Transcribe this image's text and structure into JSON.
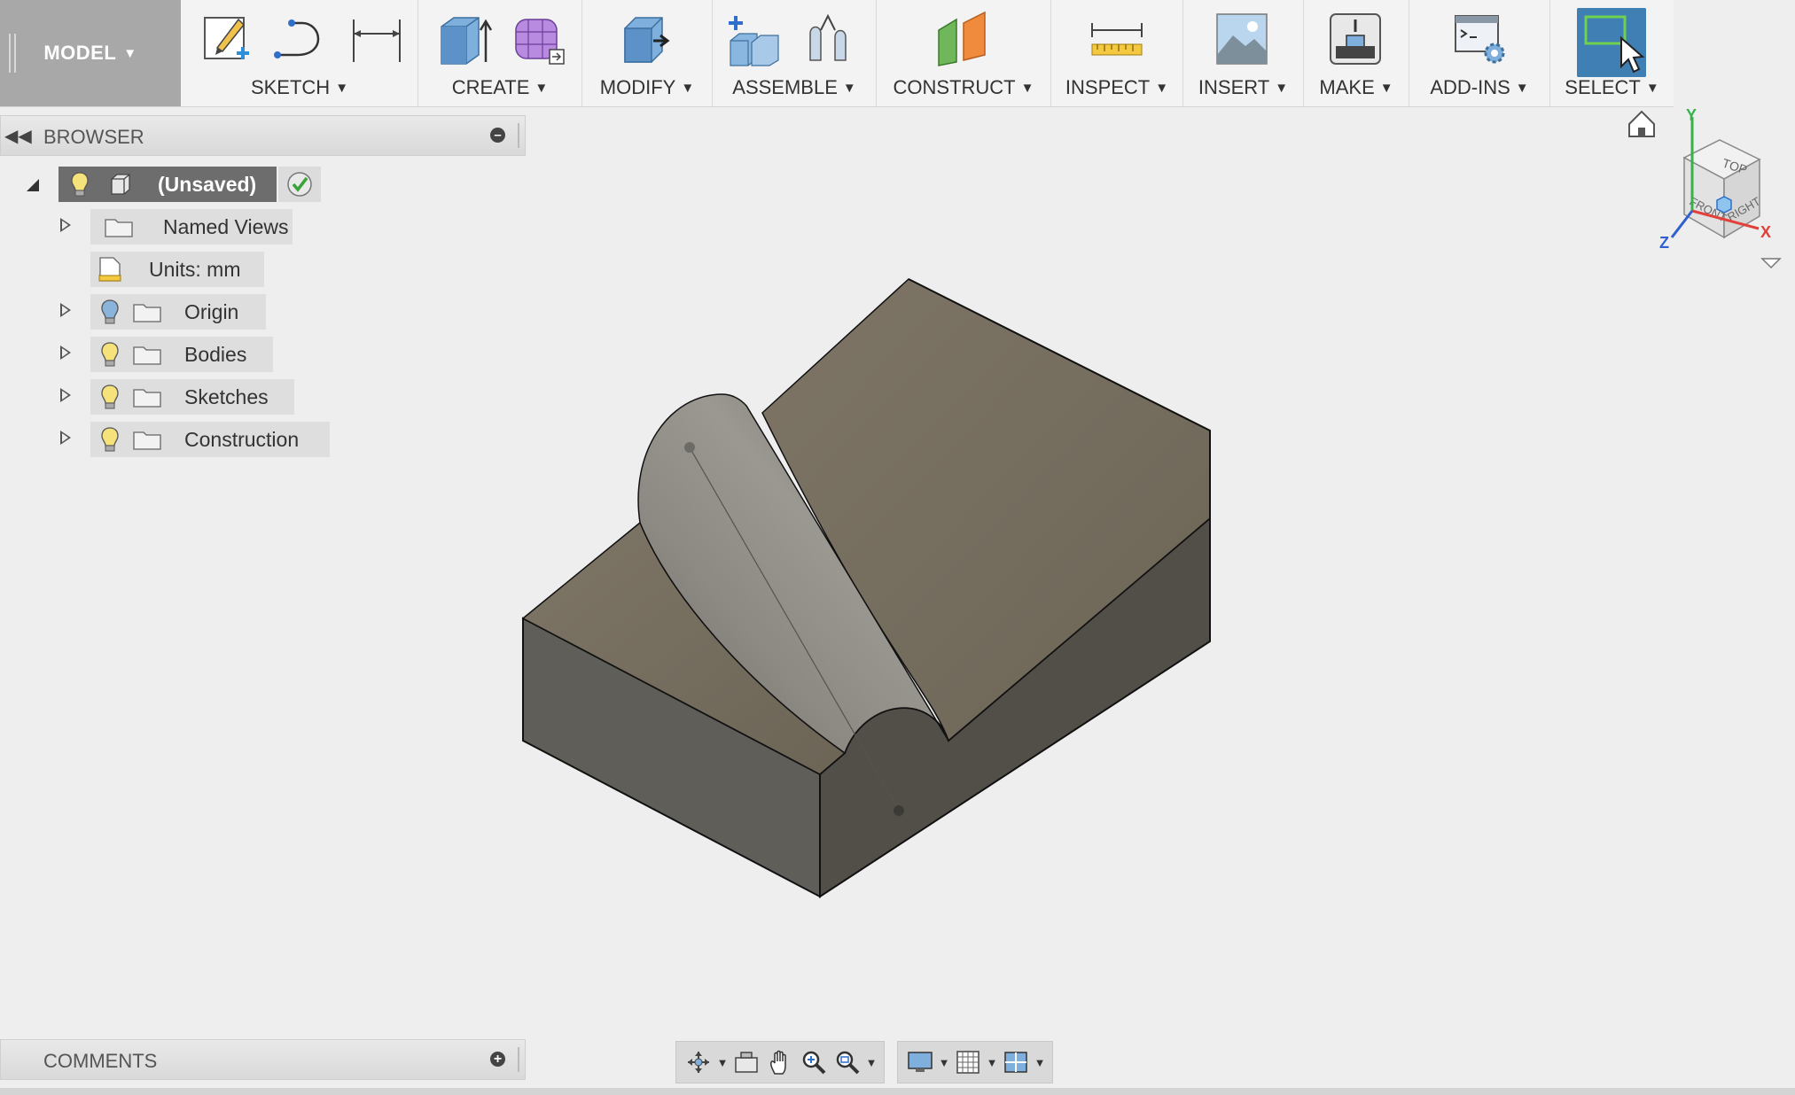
{
  "workspace": {
    "label": "MODEL",
    "icon": "caret-down-icon"
  },
  "toolbar": {
    "groups": [
      {
        "id": "sketch",
        "label": "SKETCH",
        "icons": [
          "create-sketch-icon",
          "line-icon",
          "dimension-icon"
        ]
      },
      {
        "id": "create",
        "label": "CREATE",
        "icons": [
          "extrude-icon",
          "form-icon"
        ]
      },
      {
        "id": "modify",
        "label": "MODIFY",
        "icons": [
          "press-pull-icon"
        ]
      },
      {
        "id": "assemble",
        "label": "ASSEMBLE",
        "icons": [
          "new-component-icon",
          "joint-icon"
        ]
      },
      {
        "id": "construct",
        "label": "CONSTRUCT",
        "icons": [
          "offset-plane-icon"
        ]
      },
      {
        "id": "inspect",
        "label": "INSPECT",
        "icons": [
          "measure-icon"
        ]
      },
      {
        "id": "insert",
        "label": "INSERT",
        "icons": [
          "insert-image-icon"
        ]
      },
      {
        "id": "make",
        "label": "MAKE",
        "icons": [
          "3d-print-icon"
        ]
      },
      {
        "id": "addins",
        "label": "ADD-INS",
        "icons": [
          "scripts-icon"
        ]
      },
      {
        "id": "select",
        "label": "SELECT",
        "icons": [
          "select-icon"
        ],
        "active": true
      }
    ]
  },
  "browser": {
    "title": "BROWSER",
    "root": {
      "label": "(Unsaved)",
      "status": "saved-check-icon"
    },
    "items": [
      {
        "label": "Named Views",
        "expandable": true,
        "bulb": false,
        "icon": "folder-icon"
      },
      {
        "label": "Units: mm",
        "expandable": false,
        "bulb": false,
        "icon": "ruler-doc-icon"
      },
      {
        "label": "Origin",
        "expandable": true,
        "bulb": true,
        "bulb_color": "#8ab4d9",
        "icon": "folder-icon"
      },
      {
        "label": "Bodies",
        "expandable": true,
        "bulb": true,
        "bulb_color": "#f6e27a",
        "icon": "folder-icon"
      },
      {
        "label": "Sketches",
        "expandable": true,
        "bulb": true,
        "bulb_color": "#f6e27a",
        "icon": "folder-icon"
      },
      {
        "label": "Construction",
        "expandable": true,
        "bulb": true,
        "bulb_color": "#f6e27a",
        "icon": "folder-icon"
      }
    ]
  },
  "comments": {
    "title": "COMMENTS"
  },
  "viewcube": {
    "top": "TOP",
    "front": "FRONT",
    "right": "RIGHT",
    "axis_x": "X",
    "axis_y": "Y",
    "axis_z": "Z"
  },
  "navbar": {
    "tools": [
      "orbit-icon",
      "look-at-icon",
      "pan-icon",
      "zoom-icon",
      "fit-icon"
    ],
    "display": [
      "display-settings-icon",
      "grid-icon",
      "viewports-icon"
    ]
  },
  "colors": {
    "accent": "#3f7fb3",
    "model_top": "#7b7263",
    "model_front": "#5f5d56",
    "model_right": "#534f48"
  }
}
